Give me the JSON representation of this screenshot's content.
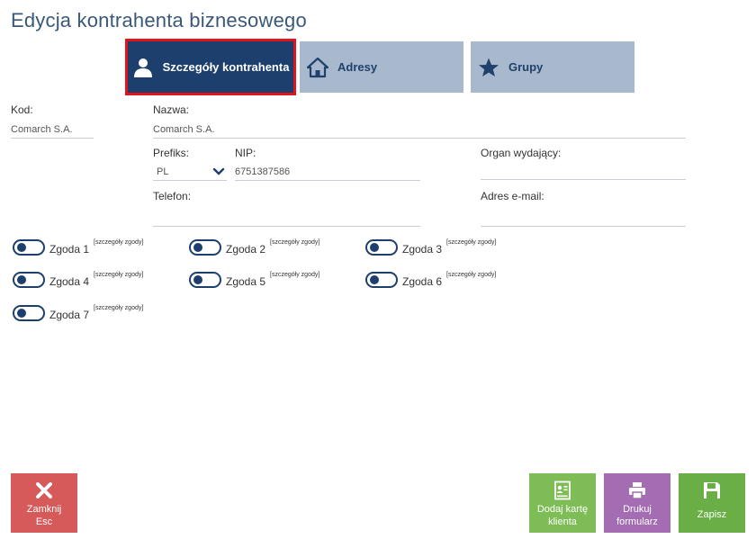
{
  "window": {
    "title": "Edycja kontrahenta biznesowego"
  },
  "tabs": [
    {
      "label": "Szczegóły kontrahenta",
      "icon": "person-icon",
      "active": true
    },
    {
      "label": "Adresy",
      "icon": "home-icon",
      "active": false
    },
    {
      "label": "Grupy",
      "icon": "star-icon",
      "active": false
    }
  ],
  "form": {
    "kod": {
      "label": "Kod:",
      "value": "Comarch S.A."
    },
    "nazwa": {
      "label": "Nazwa:",
      "value": "Comarch S.A."
    },
    "prefiks": {
      "label": "Prefiks:",
      "value": "PL"
    },
    "nip": {
      "label": "NIP:",
      "value": "6751387586"
    },
    "organ": {
      "label": "Organ wydający:",
      "value": ""
    },
    "telefon": {
      "label": "Telefon:",
      "value": ""
    },
    "email": {
      "label": "Adres e-mail:",
      "value": ""
    }
  },
  "consents": [
    {
      "label": "Zgoda 1",
      "link": "[szczegóły zgody]"
    },
    {
      "label": "Zgoda 2",
      "link": "[szczegóły zgody]"
    },
    {
      "label": "Zgoda 3",
      "link": "[szczegóły zgody]"
    },
    {
      "label": "Zgoda 4",
      "link": "[szczegóły zgody]"
    },
    {
      "label": "Zgoda 5",
      "link": "[szczegóły zgody]"
    },
    {
      "label": "Zgoda 6",
      "link": "[szczegóły zgody]"
    },
    {
      "label": "Zgoda 7",
      "link": "[szczegóły zgody]"
    }
  ],
  "buttons": {
    "close": {
      "line1": "Zamknij",
      "line2": "Esc",
      "icon": "close-icon",
      "color": "#d65a5a"
    },
    "card": {
      "line1": "Dodaj kartę",
      "line2": "klienta",
      "icon": "id-card-icon",
      "color": "#7ebd55"
    },
    "print": {
      "line1": "Drukuj",
      "line2": "formularz",
      "icon": "printer-icon",
      "color": "#a46cb2"
    },
    "save": {
      "line1": "Zapisz",
      "icon": "floppy-icon",
      "color": "#6aae46"
    }
  },
  "colors": {
    "accent": "#1d3f6e",
    "tab_inactive": "#a9b9cd",
    "highlight": "#e3131b"
  }
}
